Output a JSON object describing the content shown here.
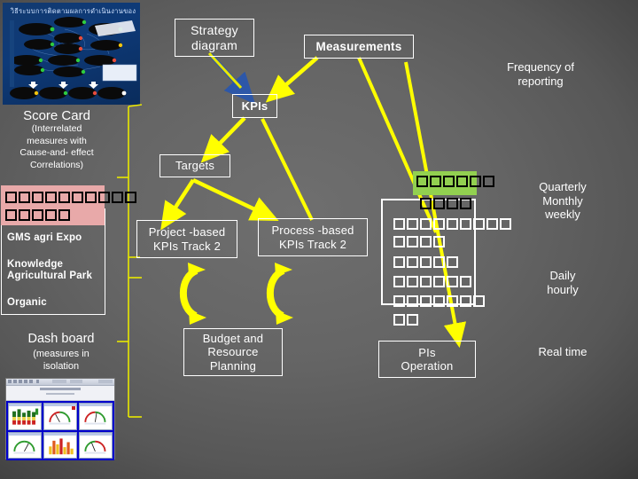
{
  "slide": {
    "title_image_caption": "วิธีระบบการติดตามผลการดำเนินงานขององค์กร",
    "background_color": "#5a5a5a",
    "accent_color": "#ffff00",
    "highlight_pink": "#e8a9a9",
    "highlight_green": "#92d050"
  },
  "boxes": {
    "strategy_diagram": "Strategy\ndiagram",
    "measurements": "Measurements",
    "kpis": "KPIs",
    "targets": "Targets",
    "project_based": "Project -based\nKPIs  Track 2",
    "process_based": "Process -based\nKPIs  Track 2",
    "budget_resource": "Budget and\nResource\nPlanning",
    "pis_operation": "PIs\nOperation",
    "left_list": "GMS agri Expo\n\nKnowledge\nAgricultural Park\n\nOrganic"
  },
  "left_list_items": [
    "GMS agri Expo",
    "Knowledge",
    "Agricultural Park",
    "Organic"
  ],
  "labels": {
    "frequency_of_reporting": "Frequency of\nreporting",
    "score_card_title": "Score Card",
    "score_card_sub": "(Interrelated\nmeasures with\nCause-and- effect\nCorrelations)",
    "quarterly_monthly_weekly": "Quarterly\nMonthly\nweekly",
    "daily_hourly": "Daily\nhourly",
    "real_time": "Real time",
    "dash_board_title": "Dash board",
    "dash_board_sub": "(measures in\nisolation"
  },
  "glyph_blocks": {
    "pink_block": {
      "fill": "#e8a9a9",
      "rows": [
        10,
        5
      ],
      "glyph_color": "#000000",
      "note": "unreadable Thai text rendered as missing-glyph boxes"
    },
    "green_block": {
      "fill": "#92d050",
      "rows": [
        6,
        4
      ],
      "glyph_color": "#000000",
      "highlight_covers": 4
    },
    "white_block": {
      "rows": [
        9,
        4,
        5,
        6,
        7,
        2
      ],
      "glyph_color": "#ffffff"
    }
  },
  "dashboard_thumbnail": {
    "panel_count": 6,
    "panels": [
      "stacked-bar",
      "gauge",
      "gauge",
      "gauge",
      "bar-chart",
      "gauge"
    ],
    "frame_color": "#0000cc"
  },
  "strategy_thumbnail": {
    "background": "#11407a",
    "node_color": "#000000",
    "node_rows": [
      3,
      3,
      4,
      2,
      4
    ]
  }
}
